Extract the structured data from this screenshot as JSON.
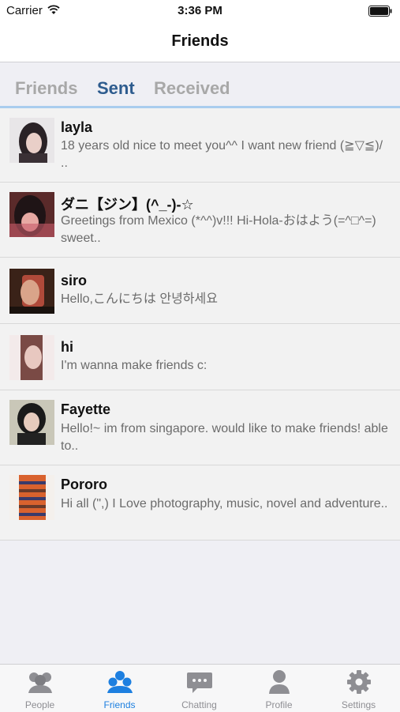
{
  "status_bar": {
    "carrier": "Carrier",
    "time": "3:36 PM"
  },
  "nav": {
    "title": "Friends"
  },
  "segments": [
    {
      "label": "Friends",
      "active": false
    },
    {
      "label": "Sent",
      "active": true
    },
    {
      "label": "Received",
      "active": false
    }
  ],
  "friends": [
    {
      "name": "layla",
      "message": "18 years old nice to meet you^^ I want new friend (≧▽≦)/ .."
    },
    {
      "name": "ダニ【ジン】(^_-)-☆",
      "message": "Greetings from Mexico (*^^)v!!! Hi-Hola-おはよう(=^□^=) sweet.."
    },
    {
      "name": "siro",
      "message": "Hello,こんにちは 안녕하세요"
    },
    {
      "name": "hi",
      "message": "I'm wanna make friends c:"
    },
    {
      "name": "Fayette",
      "message": "Hello!~ im from singapore. would like to make friends! able to.."
    },
    {
      "name": "Pororo",
      "message": "Hi all (\",) I Love photography, music, novel and adventure.."
    }
  ],
  "tab_bar": [
    {
      "label": "People",
      "icon": "people-icon",
      "active": false
    },
    {
      "label": "Friends",
      "icon": "friends-icon",
      "active": true
    },
    {
      "label": "Chatting",
      "icon": "chat-bubble-icon",
      "active": false
    },
    {
      "label": "Profile",
      "icon": "profile-icon",
      "active": false
    },
    {
      "label": "Settings",
      "icon": "gear-icon",
      "active": false
    }
  ],
  "colors": {
    "accent": "#2e5c8e",
    "tab_active": "#1d7fe0",
    "tab_inactive": "#8e8e93"
  }
}
